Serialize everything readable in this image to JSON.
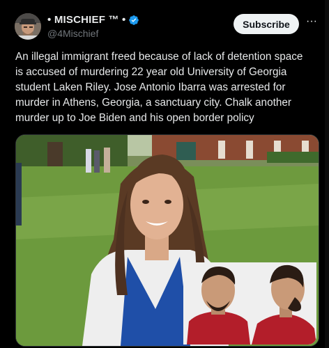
{
  "author": {
    "display_name": "• MISCHIEF ™ •",
    "handle": "@4Mischief",
    "verified": true
  },
  "actions": {
    "subscribe_label": "Subscribe",
    "more_label": "···"
  },
  "tweet": {
    "lines": [
      "An illegal immigrant freed because of lack of detention space",
      "is accused of murdering 22 year old University of Georgia",
      "student Laken Riley. Jose Antonio Ibarra was arrested for",
      "murder in Athens, Georgia, a sanctuary city. Chalk another",
      "murder up to Joe Biden and his open border policy"
    ]
  },
  "colors": {
    "background": "#000000",
    "text": "#e7e9ea",
    "muted": "#71767b",
    "verified": "#1d9bf0",
    "subscribe_bg": "#eff3f4"
  },
  "icons": {
    "verified": "verified-badge-icon",
    "more": "more-horizontal-icon"
  }
}
